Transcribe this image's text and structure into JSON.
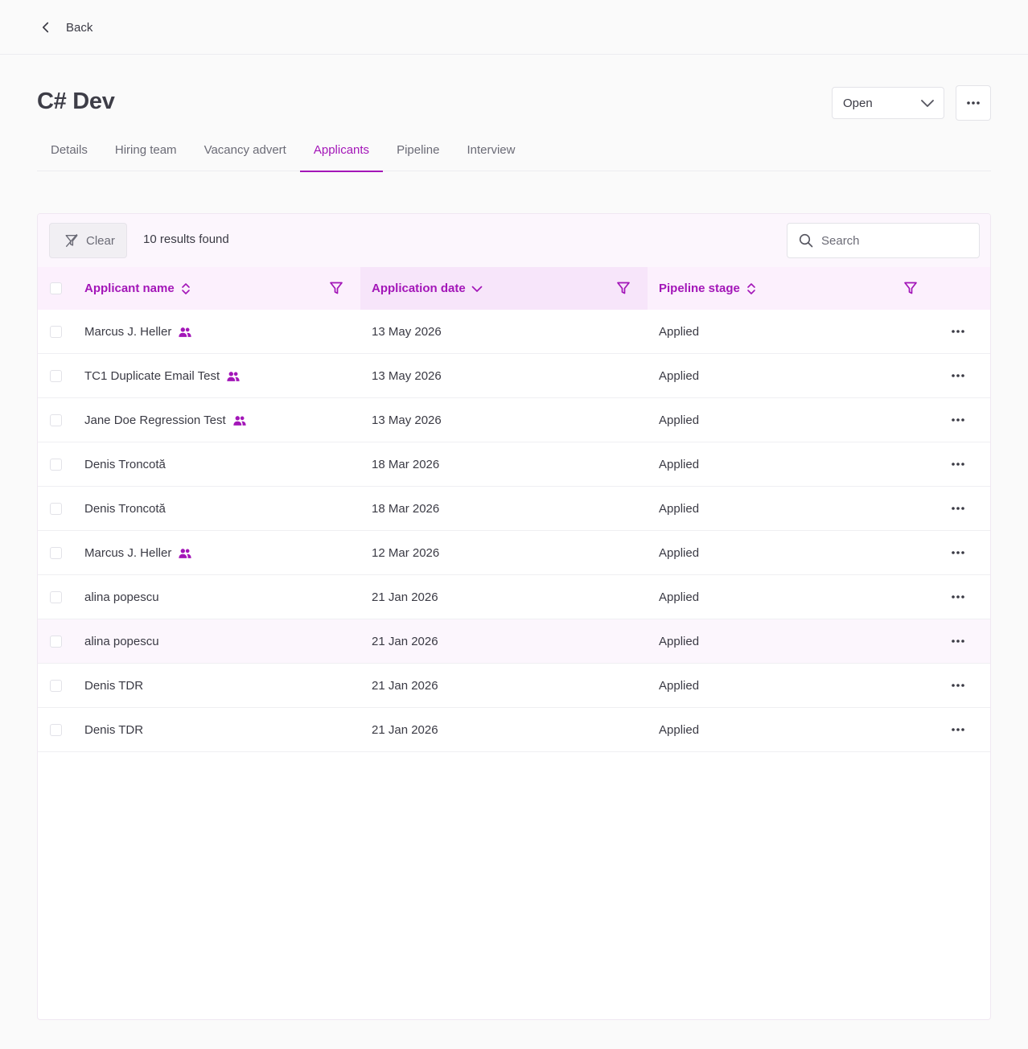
{
  "nav": {
    "back_label": "Back"
  },
  "header": {
    "title": "C# Dev",
    "status_value": "Open"
  },
  "tabs": [
    {
      "label": "Details"
    },
    {
      "label": "Hiring team"
    },
    {
      "label": "Vacancy advert"
    },
    {
      "label": "Applicants",
      "active": true
    },
    {
      "label": "Pipeline"
    },
    {
      "label": "Interview"
    }
  ],
  "toolbar": {
    "clear_label": "Clear",
    "results_text": "10 results found",
    "search_placeholder": "Search"
  },
  "columns": {
    "name": "Applicant name",
    "date": "Application date",
    "stage": "Pipeline stage"
  },
  "rows": [
    {
      "name": "Marcus J. Heller",
      "duplicate_icon": true,
      "date": "13 May 2026",
      "stage": "Applied"
    },
    {
      "name": "TC1 Duplicate Email Test",
      "duplicate_icon": true,
      "date": "13 May 2026",
      "stage": "Applied"
    },
    {
      "name": "Jane Doe Regression Test",
      "duplicate_icon": true,
      "date": "13 May 2026",
      "stage": "Applied"
    },
    {
      "name": "Denis Troncotă",
      "duplicate_icon": false,
      "date": "18 Mar 2026",
      "stage": "Applied"
    },
    {
      "name": "Denis Troncotă",
      "duplicate_icon": false,
      "date": "18 Mar 2026",
      "stage": "Applied"
    },
    {
      "name": "Marcus J. Heller",
      "duplicate_icon": true,
      "date": "12 Mar 2026",
      "stage": "Applied"
    },
    {
      "name": "alina popescu",
      "duplicate_icon": false,
      "date": "21 Jan 2026",
      "stage": "Applied"
    },
    {
      "name": "alina popescu",
      "duplicate_icon": false,
      "date": "21 Jan 2026",
      "stage": "Applied",
      "hovered": true
    },
    {
      "name": "Denis TDR",
      "duplicate_icon": false,
      "date": "21 Jan 2026",
      "stage": "Applied"
    },
    {
      "name": "Denis TDR",
      "duplicate_icon": false,
      "date": "21 Jan 2026",
      "stage": "Applied"
    }
  ],
  "colors": {
    "accent": "#a316b8",
    "header_bg": "#fcf0fd",
    "sorted_header_bg": "#f7e5fa"
  },
  "icons": [
    "chevron-left-icon",
    "chevron-down-icon",
    "more-horizontal-icon",
    "filter-off-icon",
    "search-icon",
    "sort-icon",
    "sort-desc-icon",
    "filter-icon",
    "people-icon"
  ]
}
